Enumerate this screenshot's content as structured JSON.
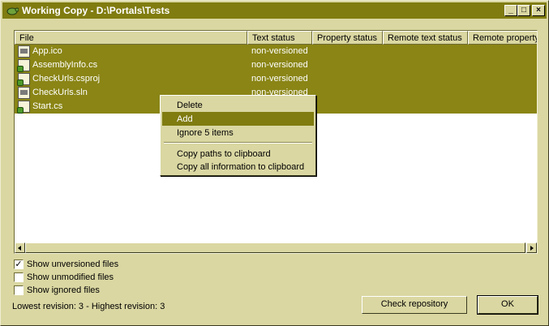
{
  "window": {
    "title": "Working Copy - D:\\Portals\\Tests",
    "controls": {
      "minimize": "_",
      "maximize": "□",
      "close": "×"
    }
  },
  "list": {
    "columns": [
      "File",
      "Text status",
      "Property status",
      "Remote text status",
      "Remote property"
    ],
    "rows": [
      {
        "file": "App.ico",
        "text_status": "non-versioned",
        "icon": "file-icon"
      },
      {
        "file": "AssemblyInfo.cs",
        "text_status": "non-versioned",
        "icon": "file-icon"
      },
      {
        "file": "CheckUrls.csproj",
        "text_status": "non-versioned",
        "icon": "project-file-icon"
      },
      {
        "file": "CheckUrls.sln",
        "text_status": "non-versioned",
        "icon": "solution-file-icon"
      },
      {
        "file": "Start.cs",
        "text_status": "",
        "icon": "file-icon"
      }
    ]
  },
  "context_menu": {
    "items": [
      "Delete",
      "Add",
      "Ignore 5 items",
      "Copy paths to clipboard",
      "Copy all information to clipboard"
    ],
    "highlighted": "Add"
  },
  "options": {
    "show_unversioned": {
      "label": "Show unversioned files",
      "checked": true,
      "mark": "✓"
    },
    "show_unmodified": {
      "label": "Show unmodified files",
      "checked": false
    },
    "show_ignored": {
      "label": "Show ignored files",
      "checked": false
    }
  },
  "status": "Lowest revision: 3 - Highest revision: 3",
  "buttons": {
    "check_repository": "Check repository",
    "ok": "OK"
  },
  "colors": {
    "selection": "#8A8515",
    "titlebar": "#807C10",
    "face": "#DAD7A2"
  }
}
